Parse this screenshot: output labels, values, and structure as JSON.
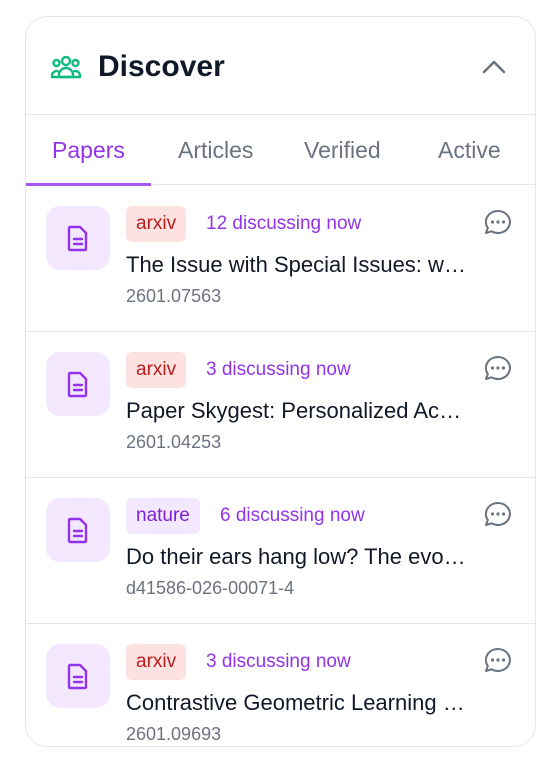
{
  "header": {
    "title": "Discover",
    "icon": "people-group-icon",
    "collapse_icon": "chevron-up-icon",
    "accent": "#10b981"
  },
  "tabs": [
    {
      "label": "Papers",
      "active": true
    },
    {
      "label": "Articles",
      "active": false
    },
    {
      "label": "Verified",
      "active": false
    },
    {
      "label": "Active",
      "active": false
    }
  ],
  "colors": {
    "accent": "#9333ea",
    "arxiv_badge_bg": "#fee2e2",
    "arxiv_badge_text": "#b91c1c",
    "nature_badge_bg": "#f3e8ff"
  },
  "papers": [
    {
      "source": "arxiv",
      "discussing": "12 discussing now",
      "title": "The Issue with Special Issues: when Guest Editors Publish in Support of Self",
      "id": "2601.07563"
    },
    {
      "source": "arxiv",
      "discussing": "3 discussing now",
      "title": "Paper Skygest: Personalized Academic Recommendations on Bluesky",
      "id": "2601.04253"
    },
    {
      "source": "nature",
      "discussing": "6 discussing now",
      "title": "Do their ears hang low? The evolution of dog ears",
      "id": "d41586-026-00071-4"
    },
    {
      "source": "arxiv",
      "discussing": "3 discussing now",
      "title": "Contrastive Geometric Learning Unlocks Unified Structure",
      "id": "2601.09693"
    }
  ]
}
